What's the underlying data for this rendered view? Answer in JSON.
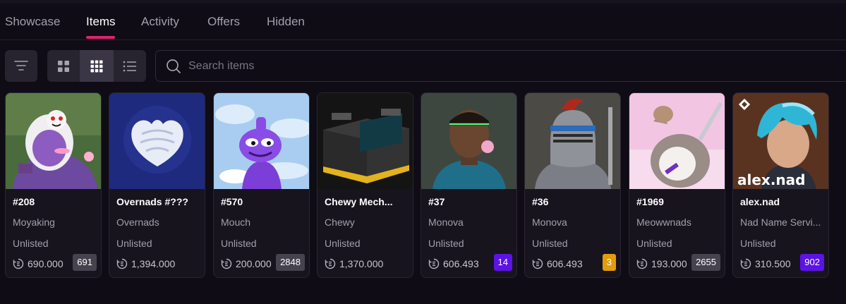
{
  "tabs": [
    {
      "label": "Showcase",
      "active": false
    },
    {
      "label": "Items",
      "active": true
    },
    {
      "label": "Activity",
      "active": false
    },
    {
      "label": "Offers",
      "active": false
    },
    {
      "label": "Hidden",
      "active": false
    }
  ],
  "toolbar": {
    "filter_icon": "filter-lines-icon",
    "view_modes": [
      {
        "icon": "grid-large-icon",
        "selected": false
      },
      {
        "icon": "grid-small-icon",
        "selected": true
      },
      {
        "icon": "list-icon",
        "selected": false
      }
    ]
  },
  "search": {
    "placeholder": "Search items",
    "value": ""
  },
  "accent_color": "#e0226b",
  "items": [
    {
      "name": "#208",
      "collection": "Moyaking",
      "status": "Unlisted",
      "price": "690.000",
      "badge": "691",
      "badge_color": "#46424e"
    },
    {
      "name": "Overnads #???",
      "collection": "Overnads",
      "status": "Unlisted",
      "price": "1,394.000",
      "badge": "",
      "badge_color": ""
    },
    {
      "name": "#570",
      "collection": "Mouch",
      "status": "Unlisted",
      "price": "200.000",
      "badge": "2848",
      "badge_color": "#46424e"
    },
    {
      "name": "Chewy Mech...",
      "collection": "Chewy",
      "status": "Unlisted",
      "price": "1,370.000",
      "badge": "",
      "badge_color": ""
    },
    {
      "name": "#37",
      "collection": "Monova",
      "status": "Unlisted",
      "price": "606.493",
      "badge": "14",
      "badge_color": "#5b13e6"
    },
    {
      "name": "#36",
      "collection": "Monova",
      "status": "Unlisted",
      "price": "606.493",
      "badge": "3",
      "badge_color": "#e39c0c"
    },
    {
      "name": "#1969",
      "collection": "Meowwnads",
      "status": "Unlisted",
      "price": "193.000",
      "badge": "2655",
      "badge_color": "#46424e"
    },
    {
      "name": "alex.nad",
      "collection": "Nad Name Servi...",
      "status": "Unlisted",
      "price": "310.500",
      "badge": "902",
      "badge_color": "#5b13e6",
      "image_text": "alex.nad"
    }
  ]
}
